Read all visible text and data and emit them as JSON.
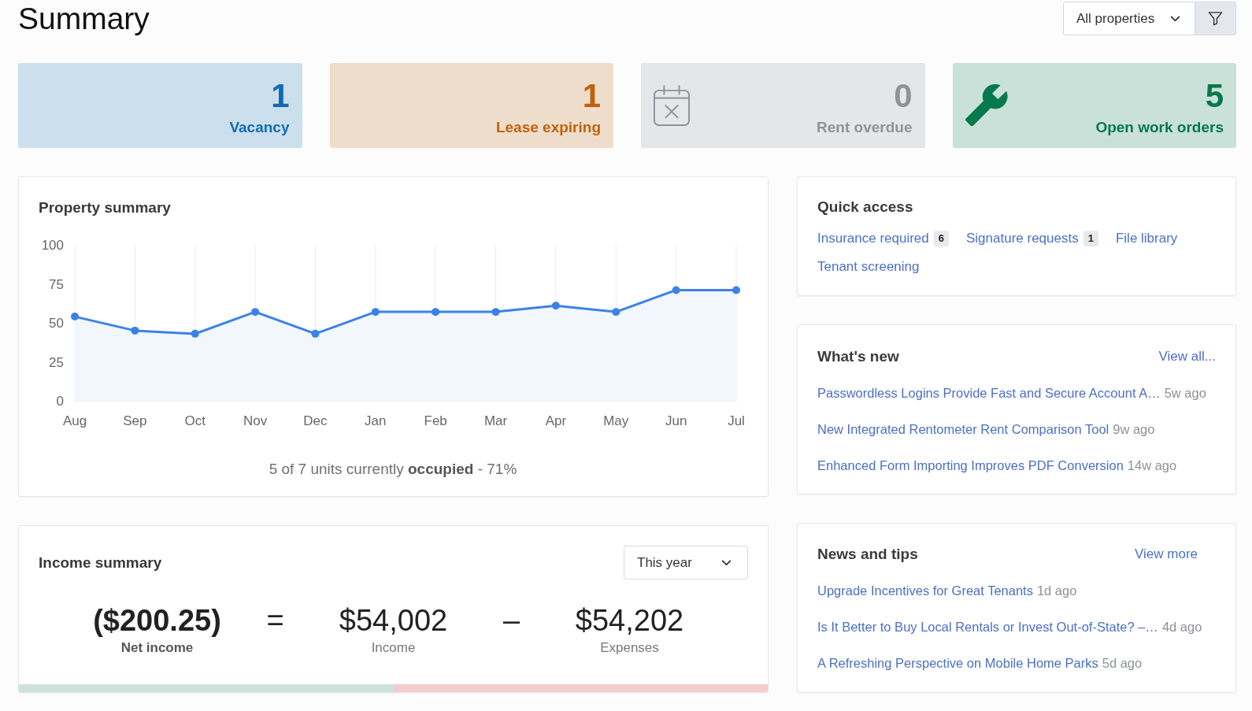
{
  "page": {
    "title": "Summary"
  },
  "property_filter": {
    "value": "All properties"
  },
  "stat_cards": [
    {
      "count": "1",
      "label": "Vacancy",
      "color": "#0f6cb0",
      "kind": "plain"
    },
    {
      "count": "1",
      "label": "Lease expiring",
      "color": "#c0620a",
      "kind": "plain"
    },
    {
      "count": "0",
      "label": "Rent overdue",
      "color": "#8e9398",
      "kind": "overdue"
    },
    {
      "count": "5",
      "label": "Open work orders",
      "color": "#06784d",
      "kind": "maintenance"
    }
  ],
  "property_summary": {
    "title": "Property summary",
    "chart_data": {
      "type": "area",
      "categories": [
        "Aug",
        "Sep",
        "Oct",
        "Nov",
        "Dec",
        "Jan",
        "Feb",
        "Mar",
        "Apr",
        "May",
        "Jun",
        "Jul"
      ],
      "values": [
        54,
        45,
        43,
        57,
        43,
        57,
        57,
        57,
        61,
        57,
        71,
        71
      ],
      "ylim": [
        0,
        100
      ],
      "yticks": [
        0,
        25,
        50,
        75,
        100
      ],
      "grid": true
    },
    "occupancy_note": "5 of 7 units currently **occupied** - 71%"
  },
  "income_summary": {
    "title": "Income summary",
    "period": {
      "value": "This year"
    },
    "terms": [
      {
        "value": "($200.25)",
        "label": "Net income",
        "kind": "net"
      },
      {
        "value": "$54,002",
        "label": "Income",
        "kind": "amount"
      },
      {
        "value": "$54,202",
        "label": "Expenses",
        "kind": "amount"
      }
    ],
    "operators": [
      "=",
      "–"
    ],
    "balance_bar": {
      "level": 0.5
    }
  },
  "quick_access": {
    "title": "Quick access",
    "links": [
      {
        "label": "Insurance required",
        "count": "6"
      },
      {
        "label": "Signature requests",
        "count": "1"
      },
      {
        "label": "File library"
      },
      {
        "label": "Tenant screening"
      }
    ]
  },
  "whats_new": {
    "title": "What's new",
    "link": "View all...",
    "items": [
      {
        "title": "Passwordless Logins Provide Fast and Secure Account A…",
        "age": "5w ago"
      },
      {
        "title": "New Integrated Rentometer Rent Comparison Tool",
        "age": "9w ago"
      },
      {
        "title": "Enhanced Form Importing Improves PDF Conversion",
        "age": "14w ago"
      }
    ]
  },
  "news_and_tips": {
    "title": "News and tips",
    "link": "View more",
    "items": [
      {
        "title": "Upgrade Incentives for Great Tenants",
        "age": "1d ago"
      },
      {
        "title": "Is It Better to Buy Local Rentals or Invest Out-of-State? –…",
        "age": "4d ago"
      },
      {
        "title": "A Refreshing Perspective on Mobile Home Parks",
        "age": "5d ago"
      }
    ]
  }
}
